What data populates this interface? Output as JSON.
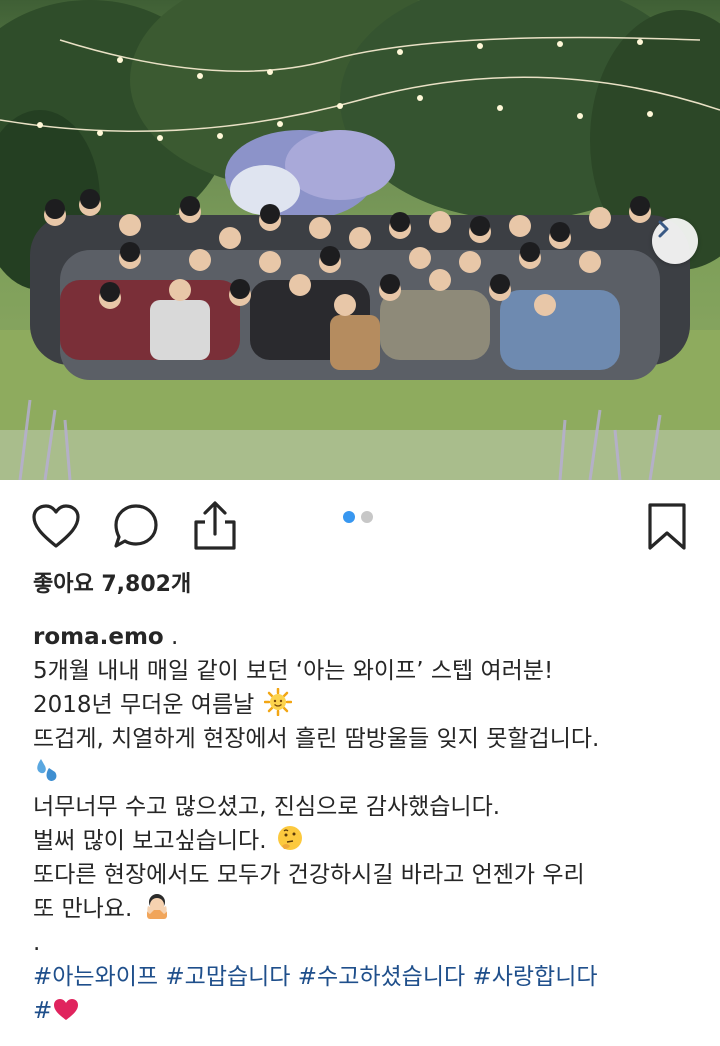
{
  "post": {
    "photo_alt": "",
    "carousel": {
      "total": 2,
      "active": 1
    }
  },
  "actions": {
    "like_icon": "heart-outline-icon",
    "comment_icon": "comment-bubble-icon",
    "share_icon": "share-upload-icon",
    "save_icon": "bookmark-outline-icon",
    "next_icon": "chevron-right-icon"
  },
  "likes": {
    "text": "좋아요 7,802개"
  },
  "caption": {
    "username": "roma.emo",
    "username_suffix": " .",
    "lines": [
      "5개월 내내 매일 같이 보던 ‘아는 와이프’ 스텝 여러분!",
      "2018년 무더운 여름날",
      "뜨겁게, 치열하게 현장에서 흘린 땀방울들 잊지 못할겁니다.",
      "",
      "너무너무 수고 많으셨고, 진심으로 감사했습니다.",
      "벌써 많이 보고싶습니다.",
      "또다른 현장에서도 모두가 건강하시길 바라고 언젠가 우리",
      "또 만나요.",
      "."
    ],
    "emojis": [
      "sun-face-icon",
      "sweat-droplets-icon",
      "thinking-face-icon",
      "hiding-face-icon"
    ],
    "hashtags": "#아는와이프 #고맙습니다 #수고하셨습니다 #사랑합니다",
    "last_hashtag": "#"
  },
  "colors": {
    "link_blue": "#1f4f8b",
    "dot_active": "#3897f0",
    "dot_inactive": "#c7c7c7",
    "heart_red": "#e0245e"
  }
}
